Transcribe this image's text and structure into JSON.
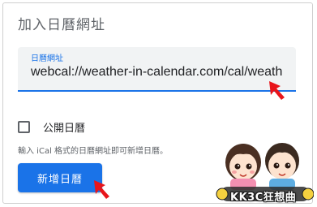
{
  "dialog": {
    "title": "加入日曆網址",
    "url_field": {
      "label": "日曆網址",
      "value": "webcal://weather-in-calendar.com/cal/weath"
    },
    "public_checkbox": {
      "label": "公開日曆",
      "checked": false
    },
    "helper_text": "輸入 iCal 格式的日曆網址即可新增日曆。",
    "add_button_label": "新增日曆"
  },
  "watermark": {
    "text": "KK3C狂想曲"
  },
  "colors": {
    "accent": "#1a73e8",
    "annotation_arrow": "#e8151b"
  }
}
